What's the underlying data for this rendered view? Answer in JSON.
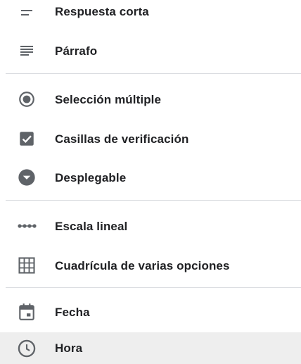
{
  "menu": {
    "items": [
      {
        "label": "Respuesta corta",
        "icon": "short-answer-icon"
      },
      {
        "label": "Párrafo",
        "icon": "paragraph-icon"
      },
      {
        "label": "Selección múltiple",
        "icon": "radio-button-icon"
      },
      {
        "label": "Casillas de verificación",
        "icon": "checkbox-icon"
      },
      {
        "label": "Desplegable",
        "icon": "dropdown-icon"
      },
      {
        "label": "Escala lineal",
        "icon": "linear-scale-icon"
      },
      {
        "label": "Cuadrícula de varias opciones",
        "icon": "grid-icon"
      },
      {
        "label": "Fecha",
        "icon": "calendar-icon"
      },
      {
        "label": "Hora",
        "icon": "clock-icon"
      }
    ],
    "highlighted_item": "Hora"
  },
  "colors": {
    "icon": "#5f6368",
    "text": "#202124",
    "divider": "#dadce0",
    "highlight": "#eeeeee"
  }
}
